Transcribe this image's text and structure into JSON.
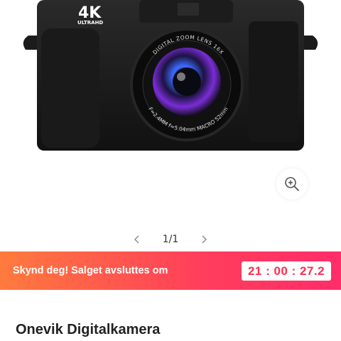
{
  "gallery": {
    "product_image": {
      "badge_4k": "4K",
      "badge_sub": "ULTRAHD",
      "lens_ring_top": "DIGITAL ZOOM LENS 16X",
      "lens_ring_bottom": "F=2.4MM f=5.04mm MACRO 52mm"
    },
    "pager": {
      "text": "1/1"
    },
    "zoom_icon": "zoom-in-icon"
  },
  "promo": {
    "message": "Skynd deg! Salget avsluttes om",
    "countdown": "21 : 00 : 27.2",
    "colors": {
      "from": "#ff7a3d",
      "to": "#ff2d6a",
      "timer_text": "#ff2d4e"
    }
  },
  "product": {
    "title": "Onevik Digitalkamera"
  }
}
